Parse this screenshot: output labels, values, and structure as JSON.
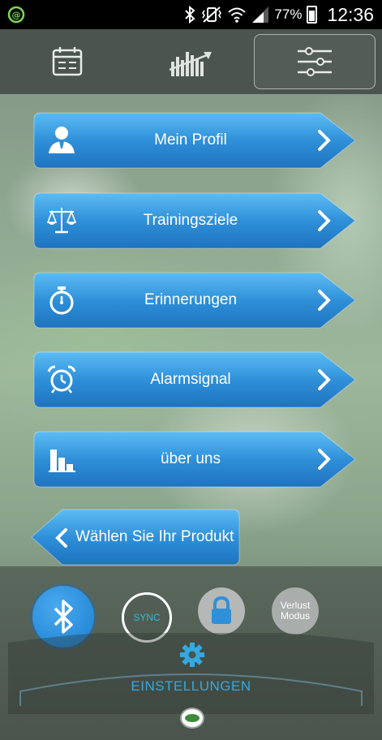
{
  "status_bar": {
    "battery_percent": "77%",
    "time": "12:36"
  },
  "toolbar": {
    "items": [
      {
        "icon": "calendar-icon"
      },
      {
        "icon": "statistics-icon"
      },
      {
        "icon": "sliders-icon",
        "active": true
      }
    ]
  },
  "menu": {
    "items": [
      {
        "label": "Mein Profil",
        "icon": "profile-icon"
      },
      {
        "label": "Trainingsziele",
        "icon": "scale-icon"
      },
      {
        "label": "Erinnerungen",
        "icon": "stopwatch-icon"
      },
      {
        "label": "Alarmsignal",
        "icon": "alarm-clock-icon"
      },
      {
        "label": "über uns",
        "icon": "bar-chart-icon"
      }
    ],
    "back_label": "Wählen Sie Ihr Produkt"
  },
  "controls": {
    "sync_label": "SYNC",
    "lost_mode_label_line1": "Verlust",
    "lost_mode_label_line2": "Modus"
  },
  "footer": {
    "section_label": "EINSTELLUNGEN"
  },
  "colors": {
    "accent": "#35a8e0",
    "button_blue": "#2f8fd8"
  }
}
